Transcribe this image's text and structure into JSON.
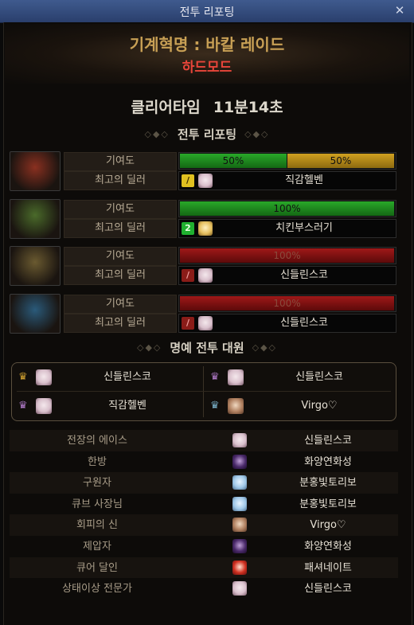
{
  "window": {
    "title": "전투 리포팅",
    "close_icon": "close-icon"
  },
  "raid": {
    "name": "기계혁명 : 바칼 레이드",
    "mode": "하드모드"
  },
  "clear": {
    "label": "클리어타임",
    "time": "11분14초"
  },
  "sections": {
    "report": "전투 리포팅",
    "honor": "명예 전투 대원"
  },
  "bosses": [
    {
      "portrait_color": "#8a3020",
      "contrib_label": "기여도",
      "dealer_label": "최고의 딜러",
      "bars": [
        {
          "text": "50%",
          "color": "green",
          "fraction": 0.5
        },
        {
          "text": "50%",
          "color": "gold",
          "fraction": 0.5
        }
      ],
      "dealer": {
        "job_icon": "/",
        "job_color": "y",
        "avatar": "white",
        "name": "직감헬벤"
      }
    },
    {
      "portrait_color": "#4a6a2a",
      "contrib_label": "기여도",
      "dealer_label": "최고의 딜러",
      "bars": [
        {
          "text": "100%",
          "color": "green",
          "fraction": 1.0
        }
      ],
      "dealer": {
        "job_icon": "2",
        "job_color": "g",
        "avatar": "blond",
        "name": "치킨부스러기"
      }
    },
    {
      "portrait_color": "#6a5a30",
      "contrib_label": "기여도",
      "dealer_label": "최고의 딜러",
      "bars": [
        {
          "text": "100%",
          "color": "red",
          "fraction": 1.0
        }
      ],
      "dealer": {
        "job_icon": "/",
        "job_color": "r",
        "avatar": "white",
        "name": "신들린스코"
      }
    },
    {
      "portrait_color": "#2a5a7a",
      "contrib_label": "기여도",
      "dealer_label": "최고의 딜러",
      "bars": [
        {
          "text": "100%",
          "color": "red",
          "fraction": 1.0
        }
      ],
      "dealer": {
        "job_icon": "/",
        "job_color": "r",
        "avatar": "white",
        "name": "신들린스코"
      }
    }
  ],
  "honor_members": [
    {
      "name": "신들린스코",
      "avatar": "white",
      "crown_color": "#d0a030"
    },
    {
      "name": "신들린스코",
      "avatar": "white",
      "crown_color": "#b07ac8"
    },
    {
      "name": "직감헬벤",
      "avatar": "white",
      "crown_color": "#b07ac8"
    },
    {
      "name": "Virgo♡",
      "avatar": "brown",
      "crown_color": "#7ab0c8"
    }
  ],
  "awards": [
    {
      "title": "전장의 에이스",
      "player": "신들린스코",
      "avatar": "white"
    },
    {
      "title": "한방",
      "player": "화양연화성",
      "avatar": "dark"
    },
    {
      "title": "구원자",
      "player": "분홍빛토리보",
      "avatar": "cyan"
    },
    {
      "title": "큐브 사장님",
      "player": "분홍빛토리보",
      "avatar": "cyan"
    },
    {
      "title": "회피의 신",
      "player": "Virgo♡",
      "avatar": "brown"
    },
    {
      "title": "제압자",
      "player": "화양연화성",
      "avatar": "dark"
    },
    {
      "title": "큐어 달인",
      "player": "패셔네이트",
      "avatar": "red"
    },
    {
      "title": "상태이상 전문가",
      "player": "신들린스코",
      "avatar": "white"
    }
  ]
}
